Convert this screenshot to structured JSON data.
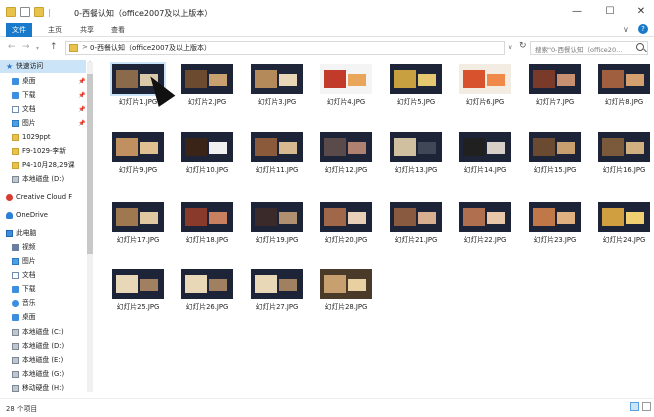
{
  "window": {
    "title": "0-西餐认知（office2007及以上版本）",
    "minimize_label": "—",
    "maximize_label": "☐",
    "close_label": "✕"
  },
  "quick_access_separator": "|",
  "ribbon": {
    "tabs": [
      "文件",
      "主页",
      "共享",
      "查看"
    ],
    "expand_label": "∨",
    "help_label": "?"
  },
  "address_bar": {
    "path": "0-西餐认知（office2007及以上版本）",
    "chevron": ">",
    "search_placeholder": "搜索\"0-西餐认知（office20...",
    "back_label": "←",
    "forward_label": "→",
    "recent_label": "▾",
    "up_label": "↑",
    "dropdown_label": "∨",
    "refresh_label": "↻"
  },
  "sidebar": {
    "items": [
      {
        "label": "快速访问",
        "icon": "star-icon",
        "selected": true,
        "pinned": false
      },
      {
        "label": "桌面",
        "icon": "desktop-icon",
        "pinned": true
      },
      {
        "label": "下载",
        "icon": "download-icon",
        "pinned": true
      },
      {
        "label": "文档",
        "icon": "document-icon",
        "pinned": true
      },
      {
        "label": "图片",
        "icon": "picture-icon",
        "pinned": true
      },
      {
        "label": "1029ppt",
        "icon": "folder-icon",
        "pinned": false
      },
      {
        "label": "F9-1029-李新",
        "icon": "folder-icon",
        "pinned": false
      },
      {
        "label": "P4-10月28,29课",
        "icon": "folder-icon",
        "pinned": false
      },
      {
        "label": "本地磁盘 (D:)",
        "icon": "drive-icon",
        "pinned": false
      },
      {
        "label": "Creative Cloud F",
        "icon": "creative-cloud-icon",
        "pinned": false
      },
      {
        "label": "OneDrive",
        "icon": "onedrive-icon",
        "pinned": false
      },
      {
        "label": "此电脑",
        "icon": "computer-icon",
        "pinned": false
      },
      {
        "label": "视频",
        "icon": "video-icon",
        "pinned": false
      },
      {
        "label": "图片",
        "icon": "picture-icon",
        "pinned": false
      },
      {
        "label": "文档",
        "icon": "document-icon",
        "pinned": false
      },
      {
        "label": "下载",
        "icon": "download-icon",
        "pinned": false
      },
      {
        "label": "音乐",
        "icon": "music-icon",
        "pinned": false
      },
      {
        "label": "桌面",
        "icon": "desktop-icon",
        "pinned": false
      },
      {
        "label": "本地磁盘 (C:)",
        "icon": "drive-icon",
        "pinned": false
      },
      {
        "label": "本地磁盘 (D:)",
        "icon": "drive-icon",
        "pinned": false
      },
      {
        "label": "本地磁盘 (E:)",
        "icon": "drive-icon",
        "pinned": false
      },
      {
        "label": "本地磁盘 (G:)",
        "icon": "drive-icon",
        "pinned": false
      },
      {
        "label": "移动硬盘 (H:)",
        "icon": "drive-icon",
        "pinned": false
      }
    ],
    "pin_glyph": "📌",
    "scroll_up_label": "▲"
  },
  "files": [
    {
      "name": "幻灯片1.JPG",
      "palette": [
        "#1e2438",
        "#8a6a4a",
        "#d9c9a8"
      ],
      "selected": true
    },
    {
      "name": "幻灯片2.JPG",
      "palette": [
        "#1e2438",
        "#6b4a30",
        "#c9a070"
      ]
    },
    {
      "name": "幻灯片3.JPG",
      "palette": [
        "#20263a",
        "#b48a5a",
        "#e8d6b6"
      ]
    },
    {
      "name": "幻灯片4.JPG",
      "palette": [
        "#f4f4f4",
        "#c23a2a",
        "#e9a65a"
      ]
    },
    {
      "name": "幻灯片5.JPG",
      "palette": [
        "#1e2438",
        "#c8a040",
        "#e6c870"
      ]
    },
    {
      "name": "幻灯片6.JPG",
      "palette": [
        "#f3ece2",
        "#d8532d",
        "#f08a4a"
      ]
    },
    {
      "name": "幻灯片7.JPG",
      "palette": [
        "#1e2438",
        "#7a3a2a",
        "#c89070"
      ]
    },
    {
      "name": "幻灯片8.JPG",
      "palette": [
        "#1e2438",
        "#a06040",
        "#d4a070"
      ]
    },
    {
      "name": "幻灯片9.JPG",
      "palette": [
        "#1e2438",
        "#c09060",
        "#e0c090"
      ]
    },
    {
      "name": "幻灯片10.JPG",
      "palette": [
        "#1e2438",
        "#3a2418",
        "#f0f0f0"
      ]
    },
    {
      "name": "幻灯片11.JPG",
      "palette": [
        "#1e2438",
        "#8a5a3a",
        "#d8b890"
      ]
    },
    {
      "name": "幻灯片12.JPG",
      "palette": [
        "#1e2438",
        "#5a4a4a",
        "#b08070"
      ]
    },
    {
      "name": "幻灯片13.JPG",
      "palette": [
        "#1e2438",
        "#d0c0a0",
        "#404858"
      ]
    },
    {
      "name": "幻灯片14.JPG",
      "palette": [
        "#1e2438",
        "#202020",
        "#d8d0c8"
      ]
    },
    {
      "name": "幻灯片15.JPG",
      "palette": [
        "#1e2438",
        "#6a4a30",
        "#c8a070"
      ]
    },
    {
      "name": "幻灯片16.JPG",
      "palette": [
        "#1e2438",
        "#7a5a3a",
        "#d0b080"
      ]
    },
    {
      "name": "幻灯片17.JPG",
      "palette": [
        "#1e2438",
        "#a07850",
        "#e0c8a0"
      ]
    },
    {
      "name": "幻灯片18.JPG",
      "palette": [
        "#1e2438",
        "#8a3a2a",
        "#c88060"
      ]
    },
    {
      "name": "幻灯片19.JPG",
      "palette": [
        "#1e2438",
        "#3a2a2a",
        "#b09070"
      ]
    },
    {
      "name": "幻灯片20.JPG",
      "palette": [
        "#1e2438",
        "#a06848",
        "#e8d0b8"
      ]
    },
    {
      "name": "幻灯片21.JPG",
      "palette": [
        "#1e2438",
        "#8a5a40",
        "#d8b090"
      ]
    },
    {
      "name": "幻灯片22.JPG",
      "palette": [
        "#1e2438",
        "#b07050",
        "#e8c8a8"
      ]
    },
    {
      "name": "幻灯片23.JPG",
      "palette": [
        "#1e2438",
        "#c07848",
        "#e0b080"
      ]
    },
    {
      "name": "幻灯片24.JPG",
      "palette": [
        "#1e2438",
        "#d0a040",
        "#f0d070"
      ]
    },
    {
      "name": "幻灯片25.JPG",
      "palette": [
        "#1e2438",
        "#e8d8b8",
        "#a08060"
      ]
    },
    {
      "name": "幻灯片26.JPG",
      "palette": [
        "#1e2438",
        "#e8d8b8",
        "#a08060"
      ]
    },
    {
      "name": "幻灯片27.JPG",
      "palette": [
        "#1e2438",
        "#e8d8b8",
        "#a08060"
      ]
    },
    {
      "name": "幻灯片28.JPG",
      "palette": [
        "#4a3a2a",
        "#c8a070",
        "#e8d0a0"
      ]
    }
  ],
  "status": {
    "item_count": "28 个项目"
  }
}
